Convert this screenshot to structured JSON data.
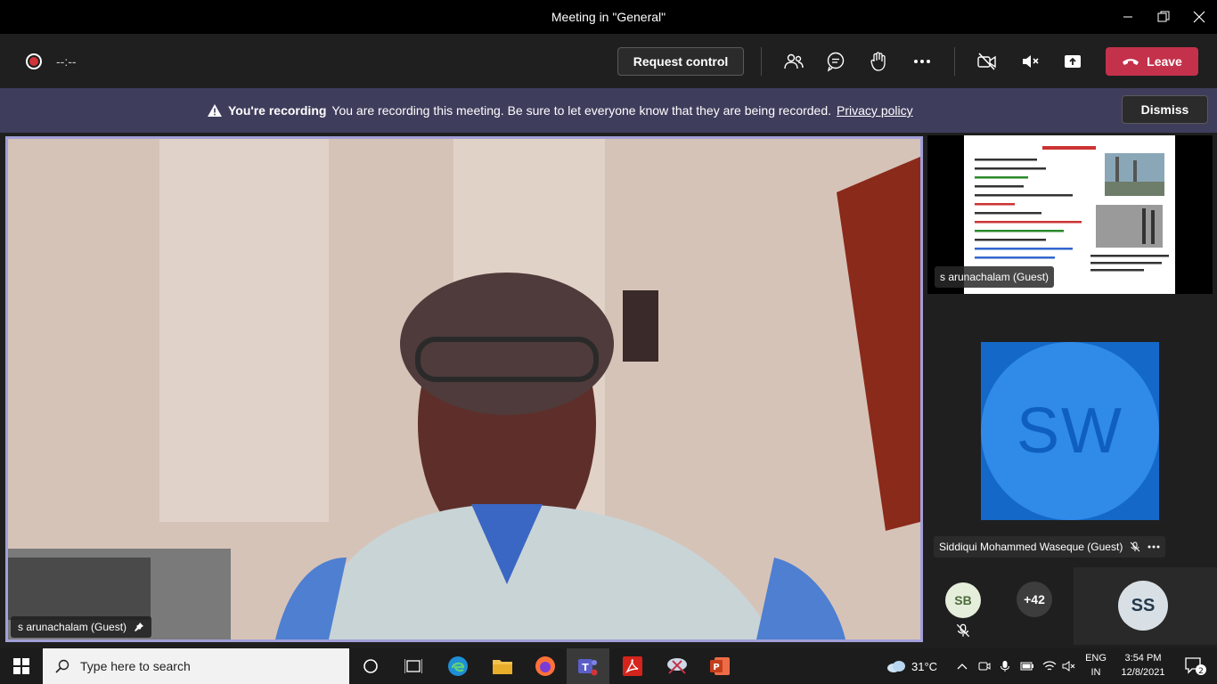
{
  "window": {
    "title": "Meeting in \"General\""
  },
  "toolbar": {
    "timer": "--:--",
    "request_control_label": "Request control",
    "leave_label": "Leave"
  },
  "banner": {
    "title": "You're recording",
    "message": "You are recording this meeting. Be sure to let everyone know that they are being recorded.",
    "link": "Privacy policy",
    "dismiss_label": "Dismiss"
  },
  "main_video": {
    "name": "s arunachalam (Guest)"
  },
  "share_tile": {
    "name": "s arunachalam (Guest)"
  },
  "participants": {
    "sw": {
      "initials": "SW",
      "name": "Siddiqui Mohammed Waseque (Guest)"
    },
    "sb": {
      "initials": "SB"
    },
    "more": "+42",
    "ss": {
      "initials": "SS"
    }
  },
  "taskbar": {
    "search_placeholder": "Type here to search",
    "temperature": "31°C",
    "lang_top": "ENG",
    "lang_bottom": "IN",
    "time": "3:54 PM",
    "date": "12/8/2021",
    "notifications": "2"
  },
  "colors": {
    "leave": "#c4314b",
    "banner": "#3f3d5c",
    "accent": "#a29fd9",
    "avatar_sw": "#2f8ae8"
  }
}
